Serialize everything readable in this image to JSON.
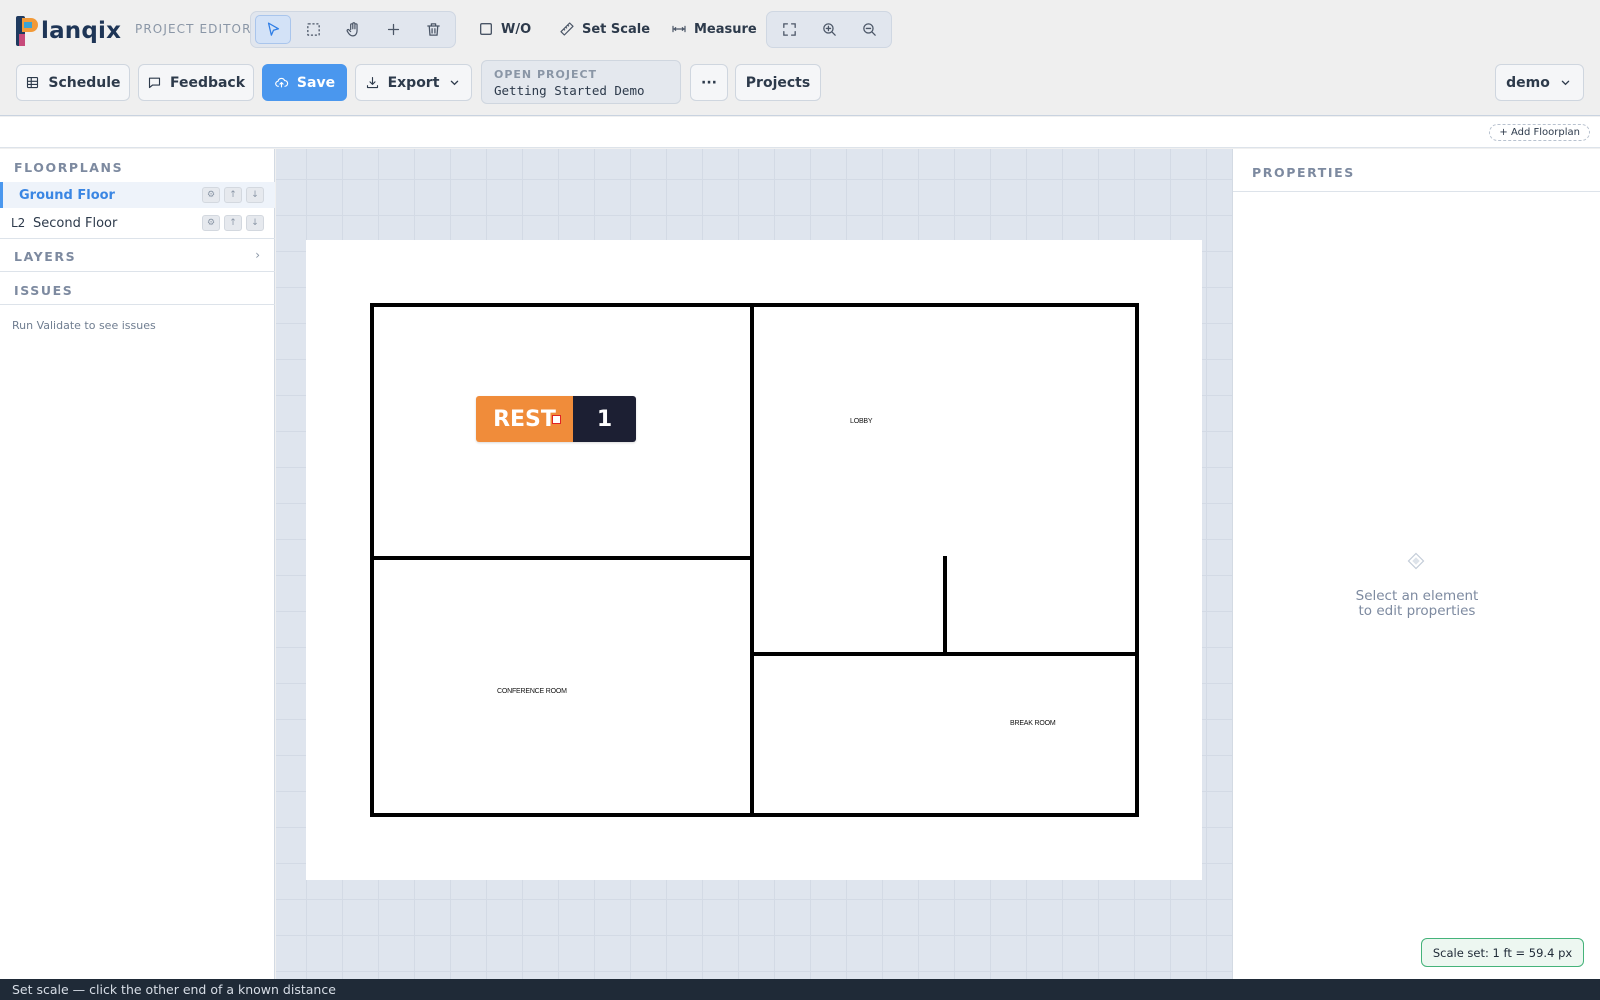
{
  "app": {
    "logo_text": "lanqix",
    "mode_label": "PROJECT EDITOR"
  },
  "toolbar": {
    "tools": [
      {
        "name": "select-tool",
        "icon": "cursor-arrow-icon",
        "active": true
      },
      {
        "name": "marquee-tool",
        "icon": "dashed-rect-icon",
        "active": false
      },
      {
        "name": "pan-tool",
        "icon": "hand-icon",
        "active": false
      },
      {
        "name": "add-tool",
        "icon": "plus-icon",
        "active": false
      },
      {
        "name": "delete-tool",
        "icon": "trash-icon",
        "active": false
      }
    ],
    "wo_label": "W/O",
    "set_scale_label": "Set Scale",
    "measure_label": "Measure",
    "view_tools": [
      "fit-screen-icon",
      "zoom-in-icon",
      "zoom-out-icon"
    ]
  },
  "actions": {
    "schedule_label": "Schedule",
    "feedback_label": "Feedback",
    "save_label": "Save",
    "export_label": "Export",
    "open_project_label": "OPEN PROJECT",
    "open_project_name": "Getting Started Demo",
    "more_label": "···",
    "projects_label": "Projects",
    "user_label": "demo"
  },
  "strip": {
    "add_floorplan_label": "+ Add Floorplan"
  },
  "left_panel": {
    "floorplans_title": "FLOORPLANS",
    "floorplans": [
      {
        "level": "",
        "name": "Ground Floor",
        "active": true
      },
      {
        "level": "L2",
        "name": "Second Floor",
        "active": false
      }
    ],
    "layers_title": "LAYERS",
    "issues_title": "ISSUES",
    "issues_text": "Run Validate to see issues"
  },
  "canvas": {
    "badge": {
      "left_text": "REST",
      "right_text": "1",
      "left_color": "#f08c3a",
      "right_color": "#1c1f33"
    },
    "rooms": [
      {
        "label": "LOBBY"
      },
      {
        "label": "CONFERENCE ROOM"
      },
      {
        "label": "BREAK ROOM"
      }
    ]
  },
  "right_panel": {
    "title": "PROPERTIES",
    "empty_line1": "Select an element",
    "empty_line2": "to edit properties"
  },
  "scale_toast": "Scale set: 1 ft = 59.4 px",
  "status_bar": "Set scale — click the other end of a known distance",
  "colors": {
    "accent": "#4a97ee",
    "status_bar_bg": "#1f2a37",
    "toast_border": "#45b37a"
  }
}
